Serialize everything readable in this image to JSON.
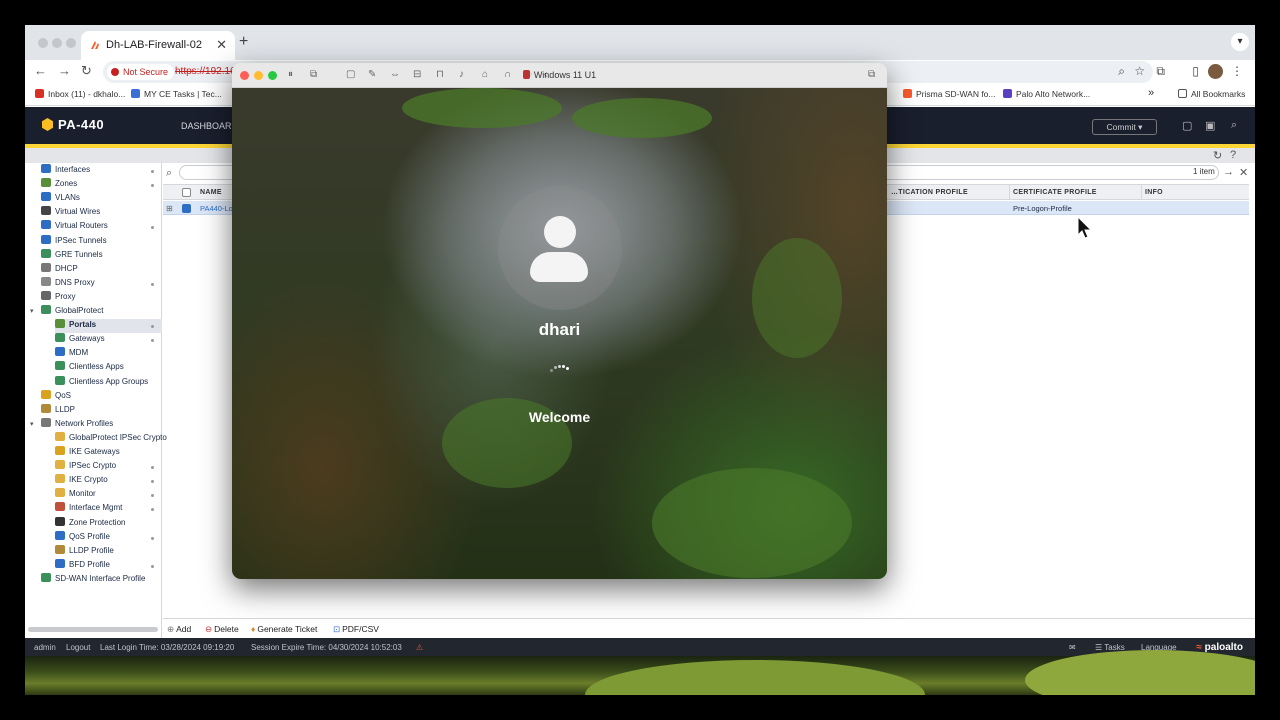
{
  "browser": {
    "tab_title": "Dh-LAB-Firewall-02",
    "tab_close": "✕",
    "new_tab": "+",
    "security_label": "Not Secure",
    "url": "https://192.16",
    "bookmarks": [
      "Inbox (11) - dkhalo...",
      "MY CE Tasks | Tec...",
      "Prisma SD-WAN fo...",
      "Palo Alto Network...",
      "All Bookmarks"
    ],
    "bookmarks_overflow": "»"
  },
  "app": {
    "device": "PA-440",
    "tab_dashboard": "DASHBOARD",
    "commit_label": "Commit ▾",
    "items_count": "1 item",
    "columns": [
      "NAME",
      "…TICATION PROFILE",
      "CERTIFICATE PROFILE",
      "INFO"
    ],
    "row": {
      "name": "PA440-Lo",
      "cert_profile": "Pre-Logon-Profile"
    },
    "nav": [
      "Interfaces",
      "Zones",
      "VLANs",
      "Virtual Wires",
      "Virtual Routers",
      "IPSec Tunnels",
      "GRE Tunnels",
      "DHCP",
      "DNS Proxy",
      "Proxy",
      "GlobalProtect",
      "Portals",
      "Gateways",
      "MDM",
      "Clientless Apps",
      "Clientless App Groups",
      "QoS",
      "LLDP",
      "Network Profiles",
      "GlobalProtect IPSec Crypto",
      "IKE Gateways",
      "IPSec Crypto",
      "IKE Crypto",
      "Monitor",
      "Interface Mgmt",
      "Zone Protection",
      "QoS Profile",
      "LLDP Profile",
      "BFD Profile",
      "SD-WAN Interface Profile"
    ],
    "actions": {
      "add": "Add",
      "delete": "Delete",
      "ticket": "Generate Ticket",
      "pdf": "PDF/CSV"
    },
    "status": {
      "user": "admin",
      "logout": "Logout",
      "last_login": "Last Login Time: 03/28/2024 09:19:20",
      "session_expire": "Session Expire Time: 04/30/2024 10:52:03",
      "tasks": "Tasks",
      "language": "Language",
      "brand": "paloalto"
    }
  },
  "vm": {
    "title": "Windows 11 U1",
    "username": "dhari",
    "welcome": "Welcome"
  }
}
